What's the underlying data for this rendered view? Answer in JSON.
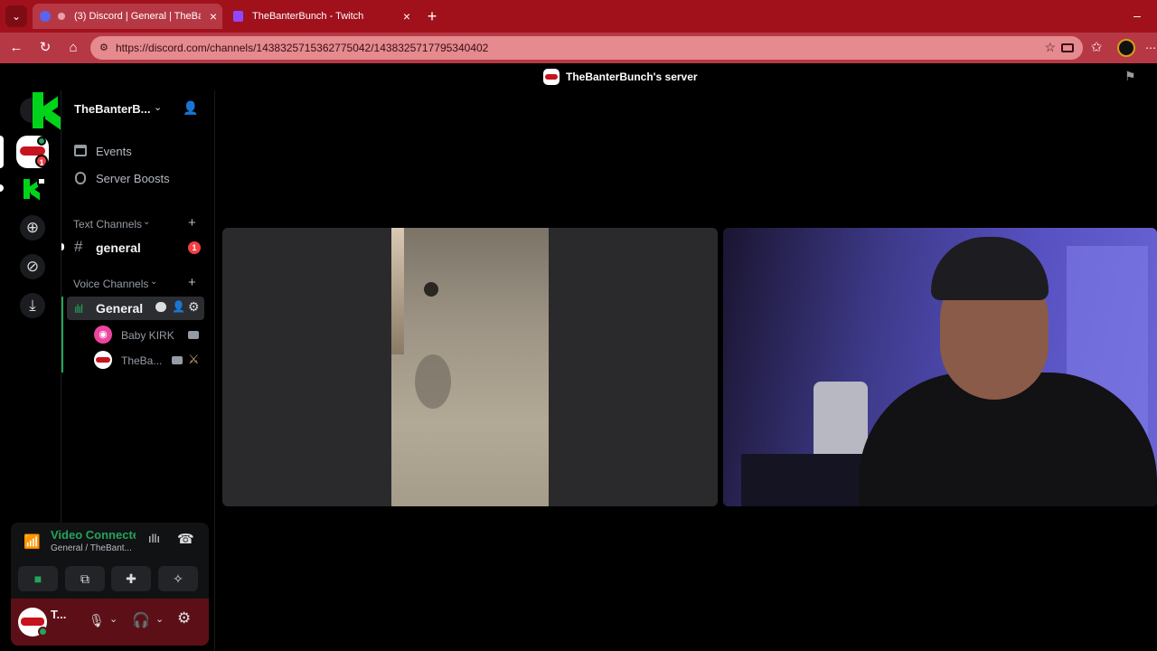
{
  "browser": {
    "tabs": [
      {
        "title": "(3) Discord | General | TheBan",
        "active": true
      },
      {
        "title": "TheBanterBunch - Twitch",
        "active": false
      }
    ],
    "url": "https://discord.com/channels/1438325715362775042/1438325717795340402"
  },
  "app": {
    "window_title": "TheBanterBunch's server",
    "overlay_text": "3"
  },
  "rail": {
    "server_badge": "1"
  },
  "sidebar": {
    "server_name": "TheBanterB...",
    "items": [
      {
        "label": "Events",
        "icon": "calendar-icon"
      },
      {
        "label": "Server Boosts",
        "icon": "boost-icon"
      }
    ],
    "text_category": "Text Channels",
    "text_channel": {
      "name": "general",
      "badge": "1"
    },
    "voice_category": "Voice Channels",
    "voice_channel": {
      "name": "General"
    },
    "voice_members": [
      {
        "name": "Baby KIRK"
      },
      {
        "name": "TheBa..."
      }
    ]
  },
  "voice_panel": {
    "status": "Video Connecte",
    "subtitle": "General / TheBant..."
  },
  "user_panel": {
    "name": "T..."
  },
  "colors": {
    "tab_bar": "#a1111c",
    "accent_green": "#23a55a",
    "badge_red": "#f23f42",
    "brand_blurple": "#5865f2"
  }
}
